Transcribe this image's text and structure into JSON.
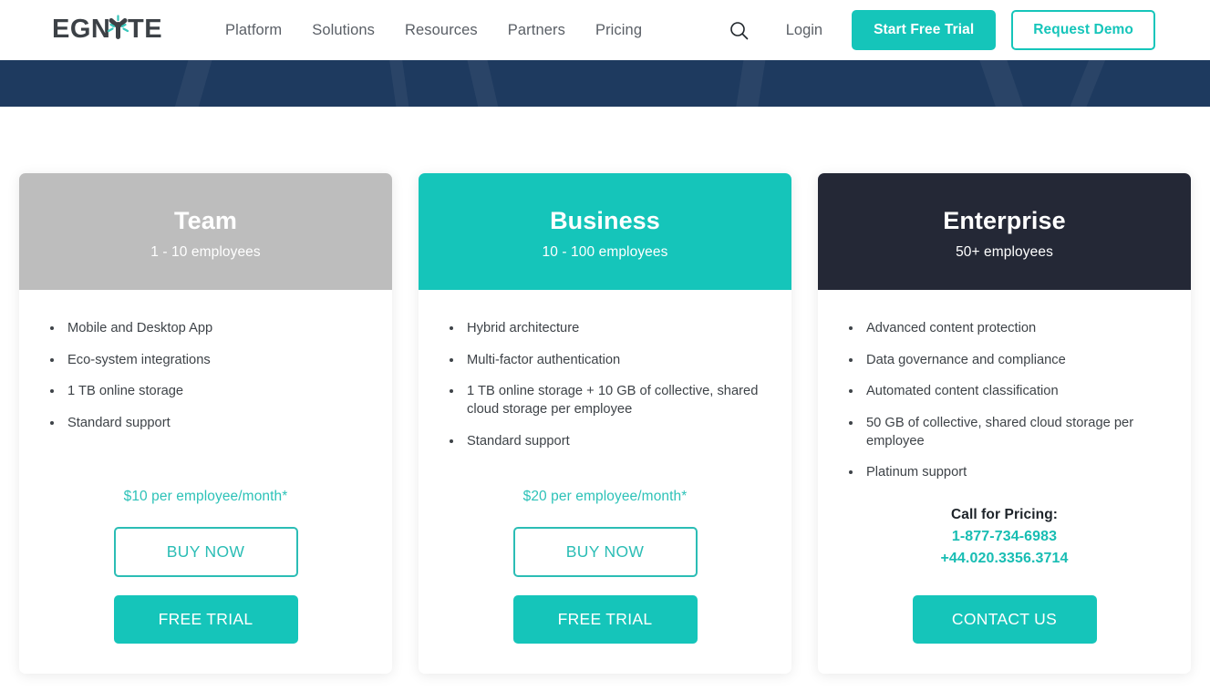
{
  "colors": {
    "teal": "#15c5ba",
    "navy_banner": "#1e3a5f",
    "enterprise_header": "#242836",
    "team_header": "#bdbdbd",
    "nav_text": "#5a5f66",
    "body_text": "#3e4348"
  },
  "header": {
    "logo_text": "EGNYTE",
    "nav": [
      {
        "label": "Platform"
      },
      {
        "label": "Solutions"
      },
      {
        "label": "Resources"
      },
      {
        "label": "Partners"
      },
      {
        "label": "Pricing"
      }
    ],
    "search_icon": "search-icon",
    "login_label": "Login",
    "start_free_trial_label": "Start Free Trial",
    "request_demo_label": "Request Demo"
  },
  "plans": [
    {
      "id": "team",
      "name": "Team",
      "subtitle": "1 - 10 employees",
      "features": [
        "Mobile and Desktop App",
        "Eco-system integrations",
        "1 TB online storage",
        "Standard support"
      ],
      "price": "$10 per employee/month*",
      "buy_label": "BUY NOW",
      "cta_label": "FREE TRIAL"
    },
    {
      "id": "business",
      "name": "Business",
      "subtitle": "10 - 100 employees",
      "features": [
        "Hybrid architecture",
        "Multi-factor authentication",
        "1 TB online storage + 10 GB of collective, shared cloud storage per employee",
        "Standard support"
      ],
      "price": "$20 per employee/month*",
      "buy_label": "BUY NOW",
      "cta_label": "FREE TRIAL"
    },
    {
      "id": "enterprise",
      "name": "Enterprise",
      "subtitle": "50+ employees",
      "features": [
        "Advanced content protection",
        "Data governance and compliance",
        "Automated content classification",
        "50 GB of collective, shared cloud storage per employee",
        "Platinum support"
      ],
      "call_label": "Call for Pricing:",
      "phone_us": "1-877-734-6983",
      "phone_uk": "+44.020.3356.3714",
      "cta_label": "CONTACT US"
    }
  ]
}
